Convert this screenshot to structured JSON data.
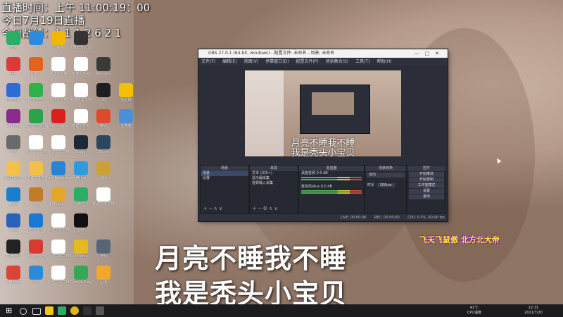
{
  "overlay": {
    "live_time": "直播时间：上午 11:00:19：00",
    "live_date": "今日7月19日直播",
    "score": "今日战绩：1 1 1 2 6 2 1"
  },
  "desktop_icons": [
    {
      "label": "微信",
      "color": "#2aae67"
    },
    {
      "label": "QQ",
      "color": "#2b8be0"
    },
    {
      "label": "小程序",
      "color": "#f2b705"
    },
    {
      "label": "OBS Studio",
      "color": "#333333"
    },
    {
      "label": "网易",
      "color": "#d93a3a"
    },
    {
      "label": "Office",
      "color": "#e0641c"
    },
    {
      "label": "新建文件夹",
      "color": "#ffffff"
    },
    {
      "label": "新建文件夹",
      "color": "#ffffff"
    },
    {
      "label": "WeGame",
      "color": "#3a3a3a"
    },
    {
      "label": "电脑管家",
      "color": "#2f6bd6"
    },
    {
      "label": "360安全卫士",
      "color": "#31b14a"
    },
    {
      "label": "新建文件夹",
      "color": "#ffffff"
    },
    {
      "label": "新建文本文档",
      "color": "#ffffff"
    },
    {
      "label": "QQ",
      "color": "#1e1e1e"
    },
    {
      "label": "快剪辑",
      "color": "#f3c100"
    },
    {
      "label": "WinRAR",
      "color": "#8a2d8a"
    },
    {
      "label": "360安全浏览器",
      "color": "#2aa34b"
    },
    {
      "label": "Among Us",
      "color": "#d9201e"
    },
    {
      "label": "新建文件夹",
      "color": "#ffffff"
    },
    {
      "label": "腾讯",
      "color": "#e04a2c"
    },
    {
      "label": "此电脑",
      "color": "#4c8fd6"
    },
    {
      "label": "小米",
      "color": "#6a6a6a"
    },
    {
      "label": "新建文本文档",
      "color": "#ffffff"
    },
    {
      "label": "新建文本文档",
      "color": "#ffffff"
    },
    {
      "label": "Steam",
      "color": "#1b2838"
    },
    {
      "label": "Steam",
      "color": "#2a475e"
    },
    {
      "label": "新建文件夹",
      "color": "#f5c04a"
    },
    {
      "label": "新建文件夹",
      "color": "#f5c04a"
    },
    {
      "label": "Fast Recorder",
      "color": "#2684d9"
    },
    {
      "label": "腾讯网",
      "color": "#2e9ae0"
    },
    {
      "label": "LOL",
      "color": "#c9a03a"
    },
    {
      "label": "Edge",
      "color": "#1b7ec9"
    },
    {
      "label": "CS",
      "color": "#c17b2b"
    },
    {
      "label": "Pubg",
      "color": "#e3a62b"
    },
    {
      "label": "微信",
      "color": "#2aae67"
    },
    {
      "label": "新建文本文档",
      "color": "#ffffff"
    },
    {
      "label": "Word",
      "color": "#2a62b8"
    },
    {
      "label": "酷狗音乐",
      "color": "#1a78d6"
    },
    {
      "label": "新建文本文档",
      "color": "#ffffff"
    },
    {
      "label": "剪映",
      "color": "#111111"
    },
    {
      "label": "直播伴侣",
      "color": "#222222"
    },
    {
      "label": "网易云音乐",
      "color": "#d73a30"
    },
    {
      "label": "新建文本文档",
      "color": "#ffffff"
    },
    {
      "label": "Chrome",
      "color": "#e8b91c"
    },
    {
      "label": "游戏",
      "color": "#556677"
    },
    {
      "label": "Chrome",
      "color": "#db4437"
    },
    {
      "label": "迅雷",
      "color": "#2d8ad9"
    },
    {
      "label": "新建文本文档",
      "color": "#ffffff"
    },
    {
      "label": "Google Play",
      "color": "#36a853"
    },
    {
      "label": "压缩",
      "color": "#f1a92b"
    }
  ],
  "obs": {
    "title": "OBS 27.0.1 (64-bit, windows) - 配置文件: 未命名 - 场景: 未命名",
    "menu": [
      "文件(F)",
      "编辑(E)",
      "视图(V)",
      "停靠窗口(D)",
      "配置文件(P)",
      "场景集合(S)",
      "工具(T)",
      "帮助(H)"
    ],
    "preview_lyrics": [
      "月亮不睡我不睡",
      "我是秃头小宝贝"
    ],
    "docks": {
      "scenes": {
        "title": "场景",
        "items": [
          "场景",
          "比赛"
        ]
      },
      "sources": {
        "title": "来源",
        "items": [
          "文本 (GDI+)",
          "显示器采集",
          "音频输入采集"
        ]
      },
      "mixer": {
        "title": "混音器",
        "items": [
          "桌面音频 0.0 dB",
          "麦克风/Aux 0.0 dB"
        ]
      },
      "transitions": {
        "title": "场景转换",
        "fade": "淡出",
        "duration_label": "时长",
        "duration": "300ms"
      },
      "controls": {
        "title": "控件",
        "buttons": [
          "开始推流",
          "开始录制",
          "工作室模式",
          "设置",
          "退出"
        ]
      }
    },
    "status": {
      "live": "LIVE: 00:00:00",
      "rec": "REC: 00:00:00",
      "cpu": "CPU: 0.5%, 60.00 fps"
    }
  },
  "lyrics": [
    "月亮不睡我不睡",
    "我是秃头小宝贝"
  ],
  "corner_text": "飞天飞鼠傲 北方北大帝",
  "taskbar": {
    "temperature": "41°C",
    "cpu_label": "CPU温度",
    "time": "12:31",
    "date": "2021/7/20"
  }
}
